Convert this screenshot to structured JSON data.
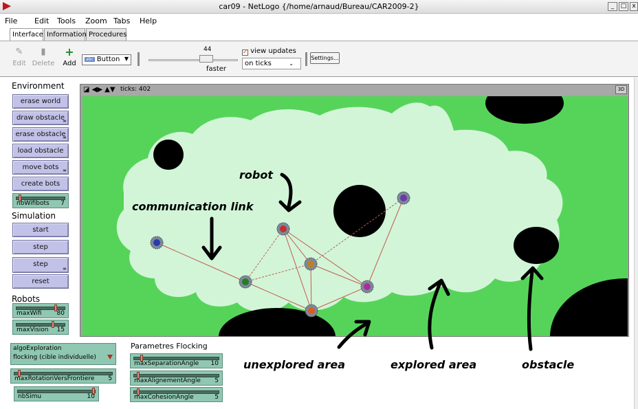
{
  "window": {
    "title": "car09 - NetLogo {/home/arnaud/Bureau/CAR2009-2}",
    "min_label": "_",
    "max_label": "□",
    "close_label": "x"
  },
  "menu": [
    "File",
    "Edit",
    "Tools",
    "Zoom",
    "Tabs",
    "Help"
  ],
  "tabs": [
    "Interface",
    "Information",
    "Procedures"
  ],
  "toolbar": {
    "edit_label": "Edit",
    "delete_label": "Delete",
    "add_label": "Add",
    "widget_type": "Button",
    "speed_value": "44",
    "speed_label": "faster",
    "view_updates_label": "view updates",
    "view_updates_checked": true,
    "update_mode": "on ticks",
    "settings_label": "Settings..."
  },
  "left_panel": {
    "environment_heading": "Environment",
    "environment_buttons": [
      "erase world",
      "draw obstacle",
      "erase obstacle",
      "load obstacle",
      "move bots",
      "create bots"
    ],
    "nbwifibots": {
      "name": "nbWifibots",
      "value": "7"
    },
    "simulation_heading": "Simulation",
    "simulation_buttons": [
      "start",
      "step",
      "step",
      "reset"
    ],
    "robots_heading": "Robots",
    "maxwifi": {
      "name": "maxWifi",
      "value": "80"
    },
    "maxvision": {
      "name": "maxVision",
      "value": "15"
    }
  },
  "bottom": {
    "chooser": {
      "name": "algoExploration",
      "value": "flocking (cible individuelle)"
    },
    "maxrotation": {
      "name": "maxRotationVersFrontiere",
      "value": "5"
    },
    "nbsimu": {
      "name": "nbSimu",
      "value": "10"
    },
    "flocking_heading": "Parametres Flocking",
    "maxseparation": {
      "name": "maxSeparationAngle",
      "value": "10"
    },
    "maxalignement": {
      "name": "maxAlignementAngle",
      "value": "5"
    },
    "maxcohesion": {
      "name": "maxCohesionAngle",
      "value": "5"
    }
  },
  "view": {
    "ticks_label": "ticks:",
    "ticks_value": "402",
    "three_d_label": "3D"
  },
  "annotations": {
    "robot": "robot",
    "communication_link": "communication link",
    "unexplored_area": "unexplored area",
    "explored_area": "explored area",
    "obstacle": "obstacle"
  },
  "colors": {
    "unexplored": "#56d45a",
    "explored": "#d2f5d8",
    "obstacle": "#000000",
    "link": "#c45a4a",
    "button": "#c2c2e8",
    "slider": "#8fc7b2"
  }
}
